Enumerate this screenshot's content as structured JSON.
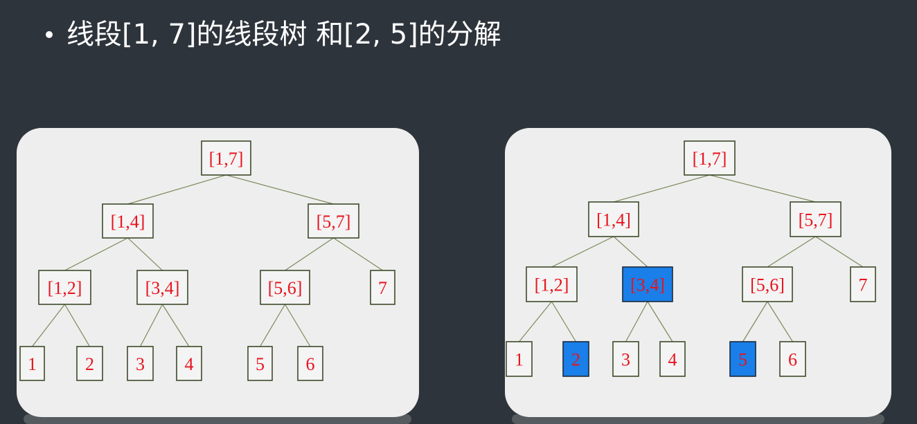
{
  "title": "线段[1, 7]的线段树 和[2, 5]的分解",
  "colors": {
    "background": "#2e343b",
    "panel": "#eeeeee",
    "node_text": "#e8141e",
    "highlight": "#1a7fe8",
    "edge": "#7a8a5a"
  },
  "trees": [
    {
      "nodes": [
        {
          "id": "n17",
          "label": "[1,7]"
        },
        {
          "id": "n14",
          "label": "[1,4]"
        },
        {
          "id": "n57",
          "label": "[5,7]"
        },
        {
          "id": "n12",
          "label": "[1,2]"
        },
        {
          "id": "n34",
          "label": "[3,4]"
        },
        {
          "id": "n56",
          "label": "[5,6]"
        },
        {
          "id": "n7",
          "label": "7"
        },
        {
          "id": "n1",
          "label": "1"
        },
        {
          "id": "n2",
          "label": "2"
        },
        {
          "id": "n3",
          "label": "3"
        },
        {
          "id": "n4",
          "label": "4"
        },
        {
          "id": "n5",
          "label": "5"
        },
        {
          "id": "n6",
          "label": "6"
        }
      ]
    },
    {
      "nodes": [
        {
          "id": "n17",
          "label": "[1,7]"
        },
        {
          "id": "n14",
          "label": "[1,4]"
        },
        {
          "id": "n57",
          "label": "[5,7]"
        },
        {
          "id": "n12",
          "label": "[1,2]"
        },
        {
          "id": "n34",
          "label": "[3,4]",
          "highlight": true
        },
        {
          "id": "n56",
          "label": "[5,6]"
        },
        {
          "id": "n7",
          "label": "7"
        },
        {
          "id": "n1",
          "label": "1"
        },
        {
          "id": "n2",
          "label": "2",
          "highlight": true
        },
        {
          "id": "n3",
          "label": "3"
        },
        {
          "id": "n4",
          "label": "4"
        },
        {
          "id": "n5",
          "label": "5",
          "highlight": true
        },
        {
          "id": "n6",
          "label": "6"
        }
      ]
    }
  ],
  "edges": [
    [
      "n17",
      "n14"
    ],
    [
      "n17",
      "n57"
    ],
    [
      "n14",
      "n12"
    ],
    [
      "n14",
      "n34"
    ],
    [
      "n57",
      "n56"
    ],
    [
      "n57",
      "n7"
    ],
    [
      "n12",
      "n1"
    ],
    [
      "n12",
      "n2"
    ],
    [
      "n34",
      "n3"
    ],
    [
      "n34",
      "n4"
    ],
    [
      "n56",
      "n5"
    ],
    [
      "n56",
      "n6"
    ]
  ]
}
